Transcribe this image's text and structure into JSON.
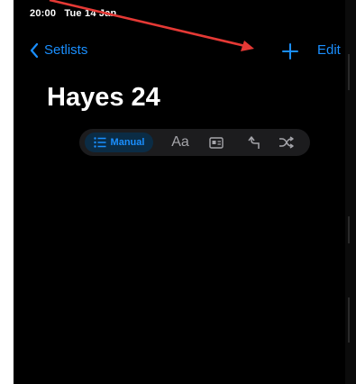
{
  "status_bar": {
    "time": "20:00",
    "date": "Tue 14 Jan"
  },
  "nav": {
    "back_label": "Setlists",
    "edit_label": "Edit"
  },
  "page": {
    "title": "Hayes 24"
  },
  "sort_control": {
    "selected": "Manual",
    "manual_label": "Manual",
    "alpha_label": "Aa",
    "icons": [
      "list-icon",
      "id-card-icon",
      "return-arrow-icon",
      "shuffle-icon"
    ]
  },
  "colors": {
    "accent": "#1a8fff",
    "background": "#000000",
    "annotation_arrow": "#e53935"
  }
}
